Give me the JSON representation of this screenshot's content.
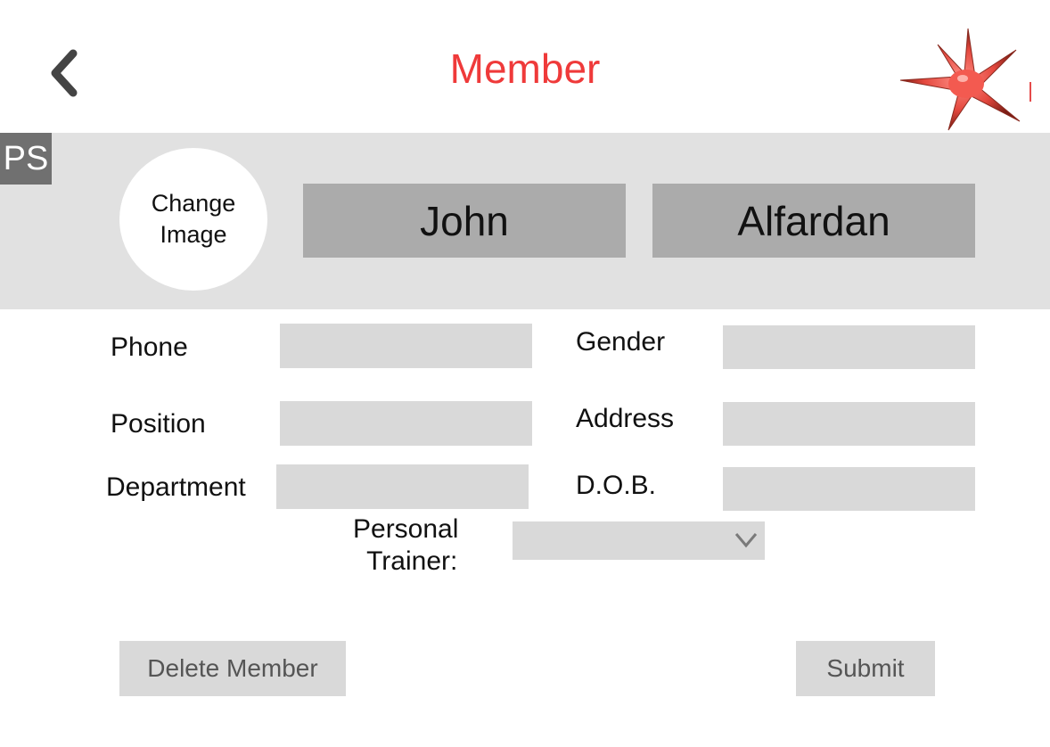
{
  "header": {
    "title": "Member",
    "back_icon": "chevron-left-icon",
    "logo_icon": "red-star-logo",
    "colors": {
      "title": "#ef3a3a",
      "band": "#e1e1e1"
    }
  },
  "profile": {
    "badge": "PS",
    "change_image": {
      "line1": "Change",
      "line2": "Image"
    },
    "first_name": "John",
    "last_name": "Alfardan"
  },
  "form": {
    "phone": {
      "label": "Phone",
      "value": ""
    },
    "position": {
      "label": "Position",
      "value": ""
    },
    "department": {
      "label": "Department",
      "value": ""
    },
    "gender": {
      "label": "Gender",
      "value": ""
    },
    "address": {
      "label": "Address",
      "value": ""
    },
    "dob": {
      "label": "D.O.B.",
      "value": ""
    },
    "trainer": {
      "label_line1": "Personal",
      "label_line2": "Trainer:",
      "selected": ""
    }
  },
  "actions": {
    "delete_label": "Delete Member",
    "submit_label": "Submit"
  }
}
